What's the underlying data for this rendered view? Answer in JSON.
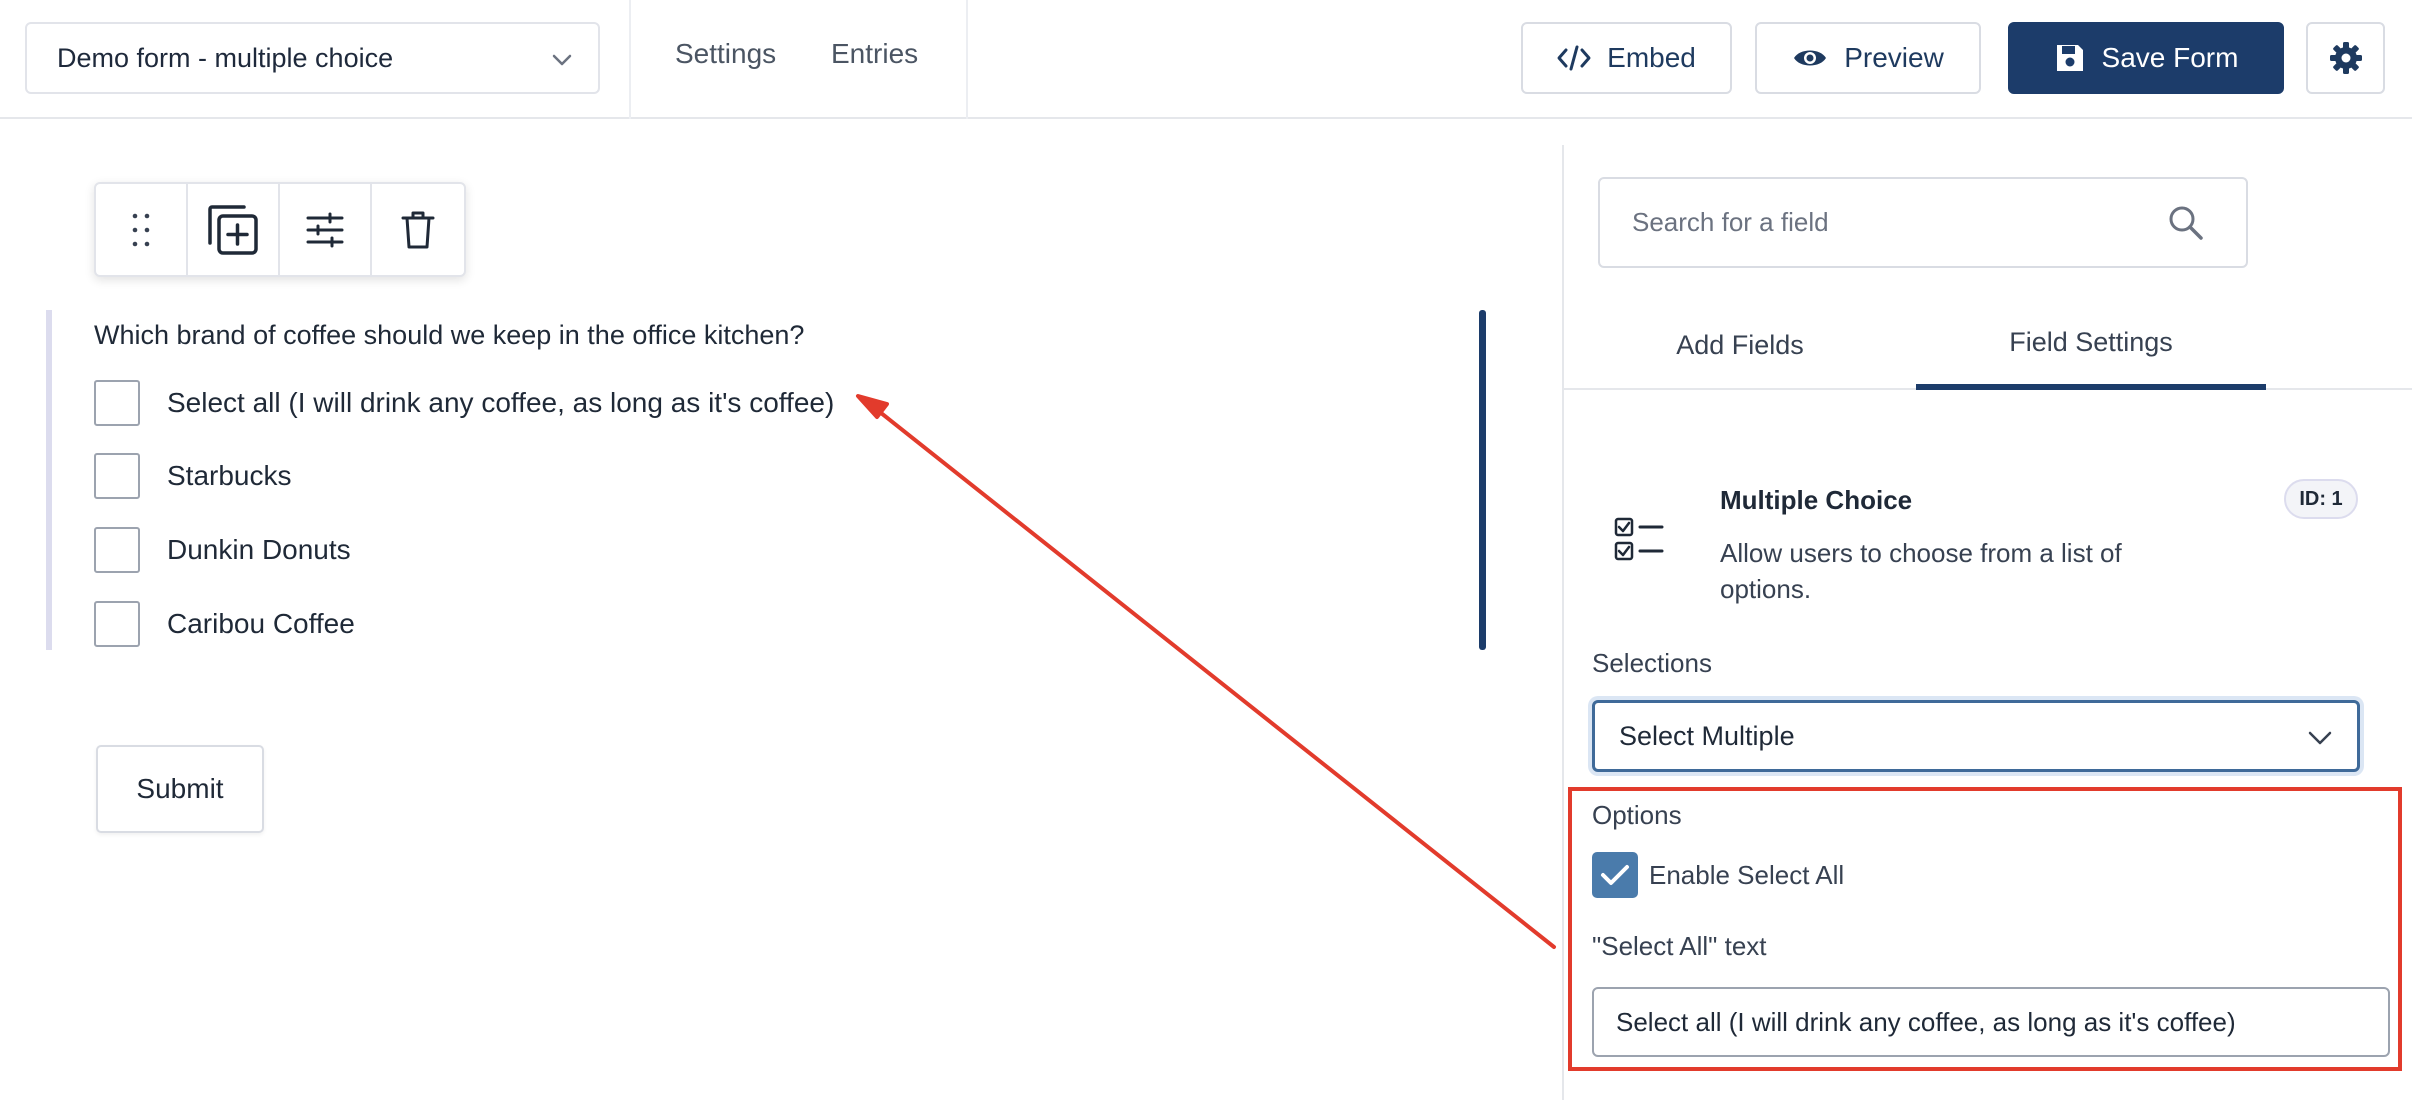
{
  "header": {
    "form_name": "Demo form - multiple choice",
    "nav": [
      "Settings",
      "Entries"
    ],
    "embed_label": "Embed",
    "preview_label": "Preview",
    "save_label": "Save Form"
  },
  "field_toolbar": {
    "icons": [
      "drag-handle-icon",
      "duplicate-icon",
      "settings-sliders-icon",
      "trash-icon"
    ]
  },
  "form": {
    "question": "Which brand of coffee should we keep in the office kitchen?",
    "choices": [
      "Select all (I will drink any coffee, as long as it's coffee)",
      "Starbucks",
      "Dunkin Donuts",
      "Caribou Coffee"
    ],
    "submit_label": "Submit"
  },
  "sidebar": {
    "search_placeholder": "Search for a field",
    "tabs": [
      "Add Fields",
      "Field Settings"
    ],
    "active_tab": "Field Settings",
    "field_type": {
      "title": "Multiple Choice",
      "description": "Allow users to choose from a list of options.",
      "id_badge": "ID: 1"
    },
    "selections_label": "Selections",
    "selections_value": "Select Multiple",
    "options_label": "Options",
    "enable_select_all_label": "Enable Select All",
    "enable_select_all_checked": true,
    "select_all_text_label": "\"Select All\" text",
    "select_all_text_value": "Select all (I will drink any coffee, as long as it's coffee)"
  },
  "annotation": {
    "highlight_color": "#e23b2c"
  },
  "colors": {
    "primary": "#1c3c6a",
    "checkbox": "#4a7bab"
  }
}
